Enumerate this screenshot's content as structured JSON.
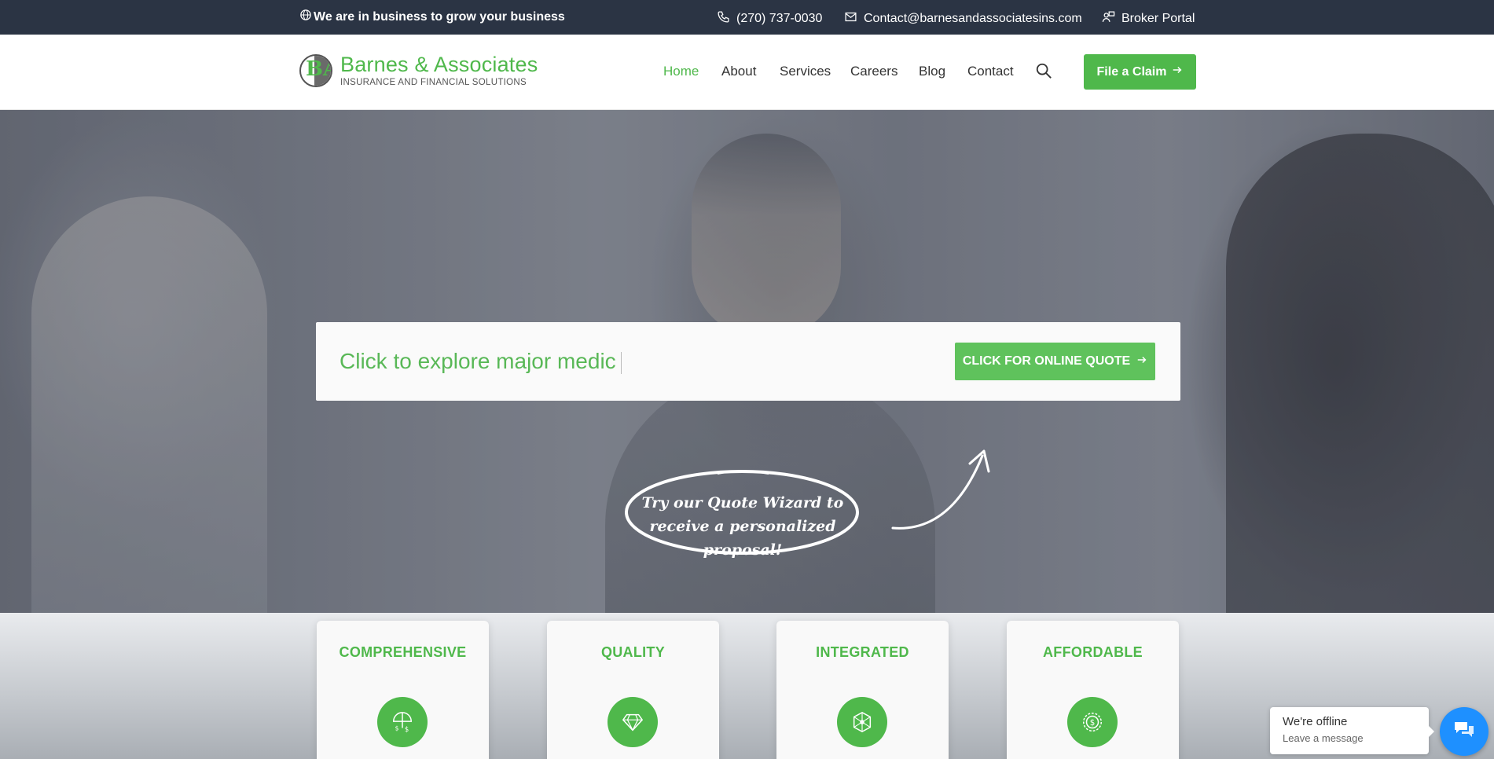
{
  "topbar": {
    "tagline": "We are in business to grow your business",
    "phone": "(270) 737-0030",
    "email": "Contact@barnesandassociatesins.com",
    "broker_portal": "Broker Portal"
  },
  "header": {
    "logo_name": "Barnes & Associates",
    "logo_sub": "INSURANCE AND FINANCIAL SOLUTIONS",
    "logo_letters": "BA",
    "nav": [
      {
        "label": "Home",
        "active": true
      },
      {
        "label": "About",
        "active": false
      },
      {
        "label": "Services",
        "active": false
      },
      {
        "label": "Careers",
        "active": false
      },
      {
        "label": "Blog",
        "active": false
      },
      {
        "label": "Contact",
        "active": false
      }
    ],
    "claim_label": "File a Claim"
  },
  "hero": {
    "typed_text": "Click to explore major medic",
    "quote_button": "CLICK FOR ONLINE QUOTE",
    "wizard_text": "Try our Quote Wizard to receive a personalized proposal!"
  },
  "features": [
    {
      "title": "COMPREHENSIVE",
      "icon": "umbrella-dollar-icon"
    },
    {
      "title": "QUALITY",
      "icon": "diamond-icon"
    },
    {
      "title": "INTEGRATED",
      "icon": "network-icon"
    },
    {
      "title": "AFFORDABLE",
      "icon": "dollar-coin-icon"
    }
  ],
  "chat": {
    "title": "We're offline",
    "subtitle": "Leave a message"
  },
  "colors": {
    "accent": "#4fb84b",
    "topbar": "#2b3444",
    "chat": "#1e90ff"
  }
}
